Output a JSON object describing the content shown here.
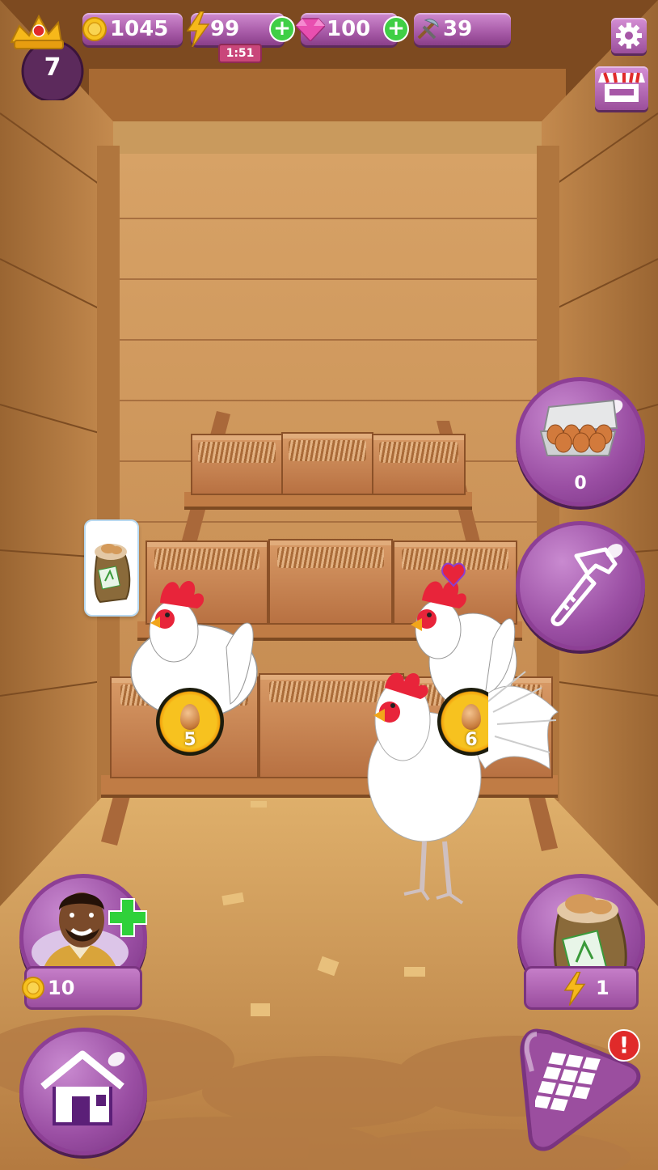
{
  "hud": {
    "level": "7",
    "coins": "1045",
    "energy": "99",
    "energy_timer": "1:51",
    "gems": "100",
    "tools": "39"
  },
  "right_panel": {
    "egg_carton_count": "0"
  },
  "nest_badges": {
    "left_count": "5",
    "right_count": "6"
  },
  "bottom_left": {
    "farmer_cost": "10"
  },
  "bottom_right": {
    "feed_energy_cost": "1",
    "alert_mark": "!"
  },
  "colors": {
    "accent_purple": "#9b4e9f",
    "plus_green": "#3fcf45",
    "coin_gold": "#f7c21f",
    "alert_red": "#e02a2a"
  },
  "icons": [
    "crown-icon",
    "coin-icon",
    "lightning-icon",
    "gem-icon",
    "pickaxe-hammer-icon",
    "gear-icon",
    "shop-stall-icon",
    "egg-carton-icon",
    "hammer-icon",
    "feed-bag-icon",
    "house-icon",
    "grid-map-icon",
    "heart-icon",
    "green-cross-icon"
  ]
}
